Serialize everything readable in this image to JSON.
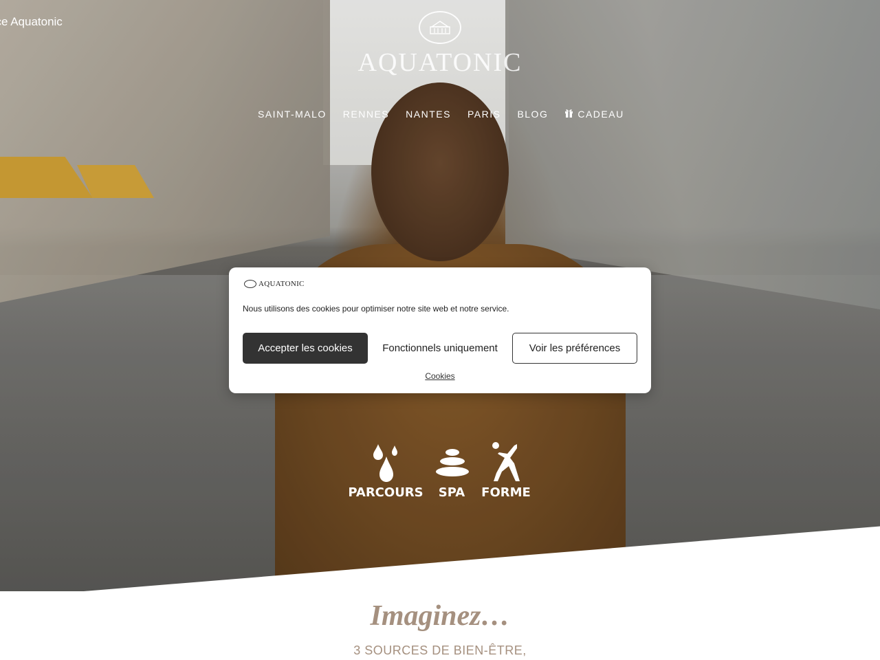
{
  "header": {
    "top_link": "ace Aquatonic",
    "logo_text": "AQUATONIC"
  },
  "nav": {
    "items": [
      {
        "label": "SAINT-MALO"
      },
      {
        "label": "RENNES"
      },
      {
        "label": "NANTES"
      },
      {
        "label": "PARIS"
      },
      {
        "label": "BLOG"
      },
      {
        "label": "CADEAU",
        "icon": "gift-icon"
      }
    ]
  },
  "features": [
    {
      "label": "PARCOURS",
      "icon": "water-drops-icon"
    },
    {
      "label": "SPA",
      "icon": "stacked-stones-icon"
    },
    {
      "label": "FORME",
      "icon": "dancer-icon"
    }
  ],
  "cookie": {
    "logo_text": "AQUATONIC",
    "message": "Nous utilisons des cookies pour optimiser notre site web et notre service.",
    "accept_label": "Accepter les cookies",
    "functional_label": "Fonctionnels uniquement",
    "preferences_label": "Voir les préférences",
    "cookies_link": "Cookies"
  },
  "content": {
    "heading": "Imaginez…",
    "subheading": "3 SOURCES DE BIEN-ÊTRE,"
  },
  "colors": {
    "accent_text": "#a5907f",
    "accept_button": "#333333"
  }
}
